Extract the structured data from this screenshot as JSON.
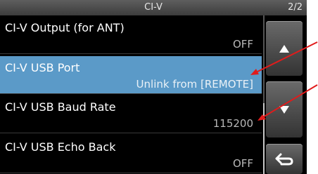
{
  "header": {
    "title": "CI-V",
    "page": "2/2"
  },
  "menu": {
    "items": [
      {
        "label": "CI-V Output (for ANT)",
        "value": "OFF",
        "selected": false
      },
      {
        "label": "CI-V USB Port",
        "value": "Unlink from [REMOTE]",
        "selected": true
      },
      {
        "label": "CI-V USB Baud Rate",
        "value": "115200",
        "selected": false
      },
      {
        "label": "CI-V USB Echo Back",
        "value": "OFF",
        "selected": false
      }
    ]
  },
  "buttons": {
    "up_icon": "triangle-up-icon",
    "down_icon": "triangle-down-icon",
    "back_icon": "return-icon"
  },
  "colors": {
    "selection": "#5b9ac8",
    "annotation_arrow": "#e11b1b"
  }
}
